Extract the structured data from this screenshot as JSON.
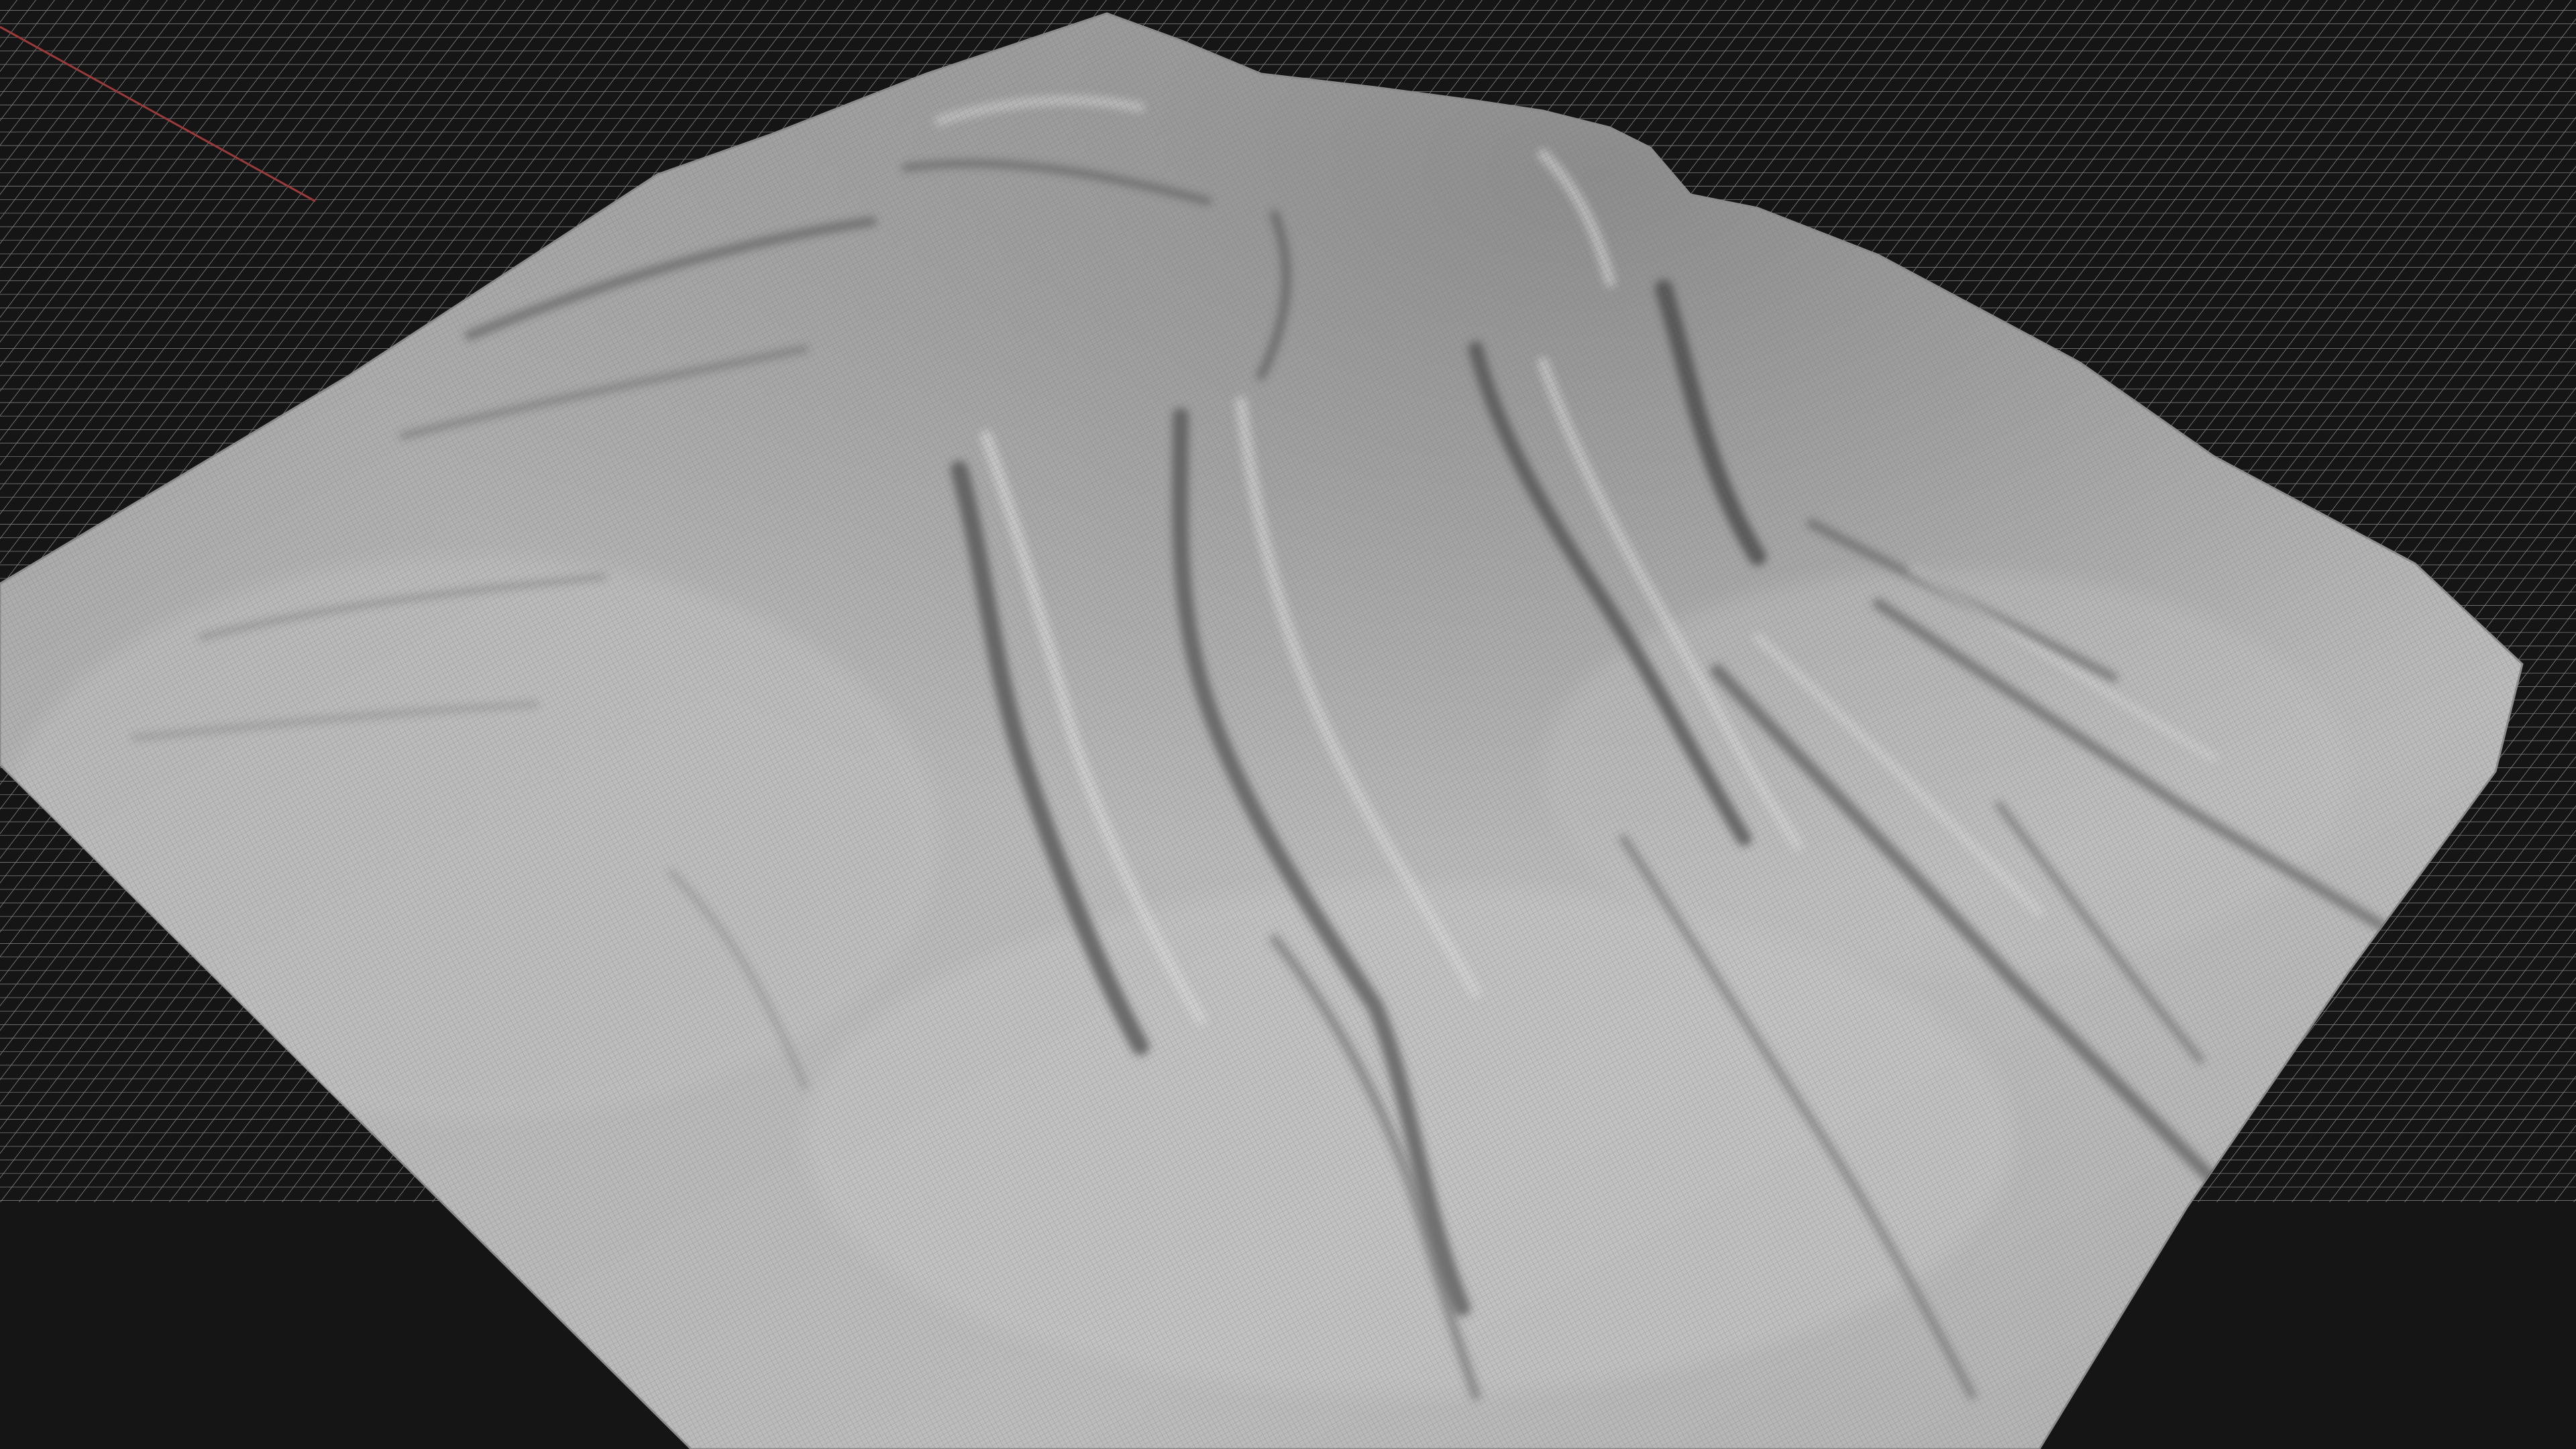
{
  "viewport": {
    "background_color": "#151515",
    "grid_line_color": "#8a8a8a",
    "terrain_base_color": "#b4b4b4",
    "terrain_shadow_color": "#5a5a5a",
    "terrain_highlight_color": "#d6d6d6",
    "wire_color": "#6e6e6e",
    "x_axis_color": "#9a3a3a",
    "z_axis_color": "#7f7f3a"
  }
}
